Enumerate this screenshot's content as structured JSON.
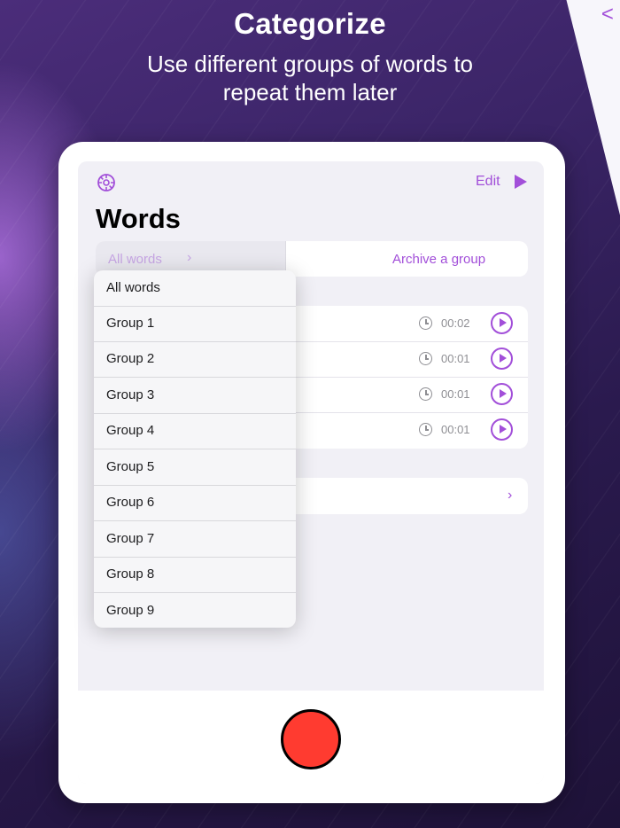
{
  "promo": {
    "headline": "Categorize",
    "subline": "Use different groups of words to repeat them later"
  },
  "header": {
    "edit_label": "Edit",
    "title": "Words"
  },
  "segmented": {
    "selector_label": "All words",
    "archive_label": "Archive a group"
  },
  "word_rows": [
    {
      "duration": "00:02"
    },
    {
      "duration": "00:01"
    },
    {
      "duration": "00:01"
    },
    {
      "duration": "00:01"
    }
  ],
  "dropdown": {
    "items": [
      "All words",
      "Group 1",
      "Group 2",
      "Group 3",
      "Group 4",
      "Group 5",
      "Group 6",
      "Group 7",
      "Group 8",
      "Group 9"
    ]
  },
  "colors": {
    "accent": "#a24fd9",
    "record": "#ff3b30"
  },
  "icons": [
    "gear-icon",
    "play-icon",
    "chevron-right-icon",
    "clock-icon",
    "play-circle-icon",
    "record-icon",
    "chevron-left-icon"
  ]
}
